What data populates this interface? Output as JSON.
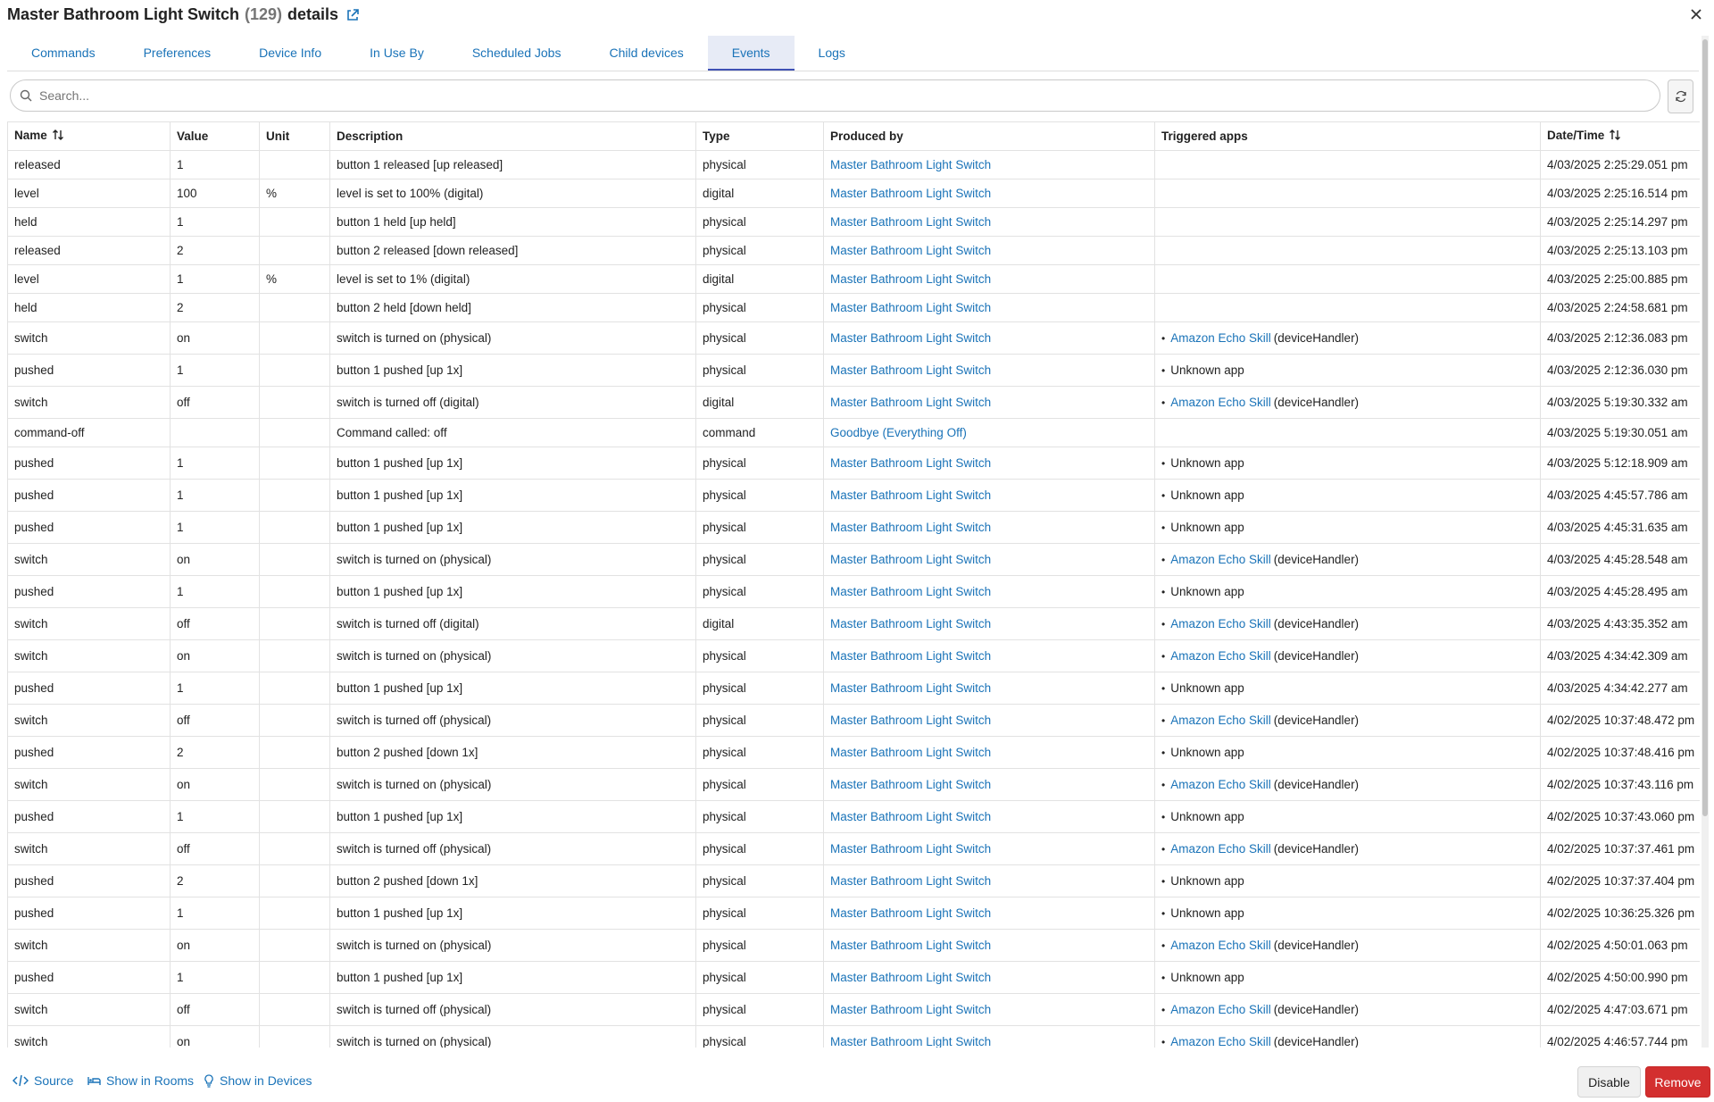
{
  "header": {
    "title": "Master Bathroom Light Switch",
    "count": "(129)",
    "suffix": "details"
  },
  "tabs": [
    {
      "label": "Commands",
      "active": false
    },
    {
      "label": "Preferences",
      "active": false
    },
    {
      "label": "Device Info",
      "active": false
    },
    {
      "label": "In Use By",
      "active": false
    },
    {
      "label": "Scheduled Jobs",
      "active": false
    },
    {
      "label": "Child devices",
      "active": false
    },
    {
      "label": "Events",
      "active": true
    },
    {
      "label": "Logs",
      "active": false
    }
  ],
  "search": {
    "placeholder": "Search...",
    "value": ""
  },
  "table": {
    "columns": [
      "Name",
      "Value",
      "Unit",
      "Description",
      "Type",
      "Produced by",
      "Triggered apps",
      "Date/Time"
    ],
    "rows": [
      {
        "name": "released",
        "value": "1",
        "unit": "",
        "description": "button 1 released [up released]",
        "type": "physical",
        "produced_by": "Master Bathroom Light Switch",
        "app": "",
        "app_suffix": "",
        "datetime": "4/03/2025 2:25:29.051 pm"
      },
      {
        "name": "level",
        "value": "100",
        "unit": "%",
        "description": "level is set to 100% (digital)",
        "type": "digital",
        "produced_by": "Master Bathroom Light Switch",
        "app": "",
        "app_suffix": "",
        "datetime": "4/03/2025 2:25:16.514 pm"
      },
      {
        "name": "held",
        "value": "1",
        "unit": "",
        "description": "button 1 held [up held]",
        "type": "physical",
        "produced_by": "Master Bathroom Light Switch",
        "app": "",
        "app_suffix": "",
        "datetime": "4/03/2025 2:25:14.297 pm"
      },
      {
        "name": "released",
        "value": "2",
        "unit": "",
        "description": "button 2 released [down released]",
        "type": "physical",
        "produced_by": "Master Bathroom Light Switch",
        "app": "",
        "app_suffix": "",
        "datetime": "4/03/2025 2:25:13.103 pm"
      },
      {
        "name": "level",
        "value": "1",
        "unit": "%",
        "description": "level is set to 1% (digital)",
        "type": "digital",
        "produced_by": "Master Bathroom Light Switch",
        "app": "",
        "app_suffix": "",
        "datetime": "4/03/2025 2:25:00.885 pm"
      },
      {
        "name": "held",
        "value": "2",
        "unit": "",
        "description": "button 2 held [down held]",
        "type": "physical",
        "produced_by": "Master Bathroom Light Switch",
        "app": "",
        "app_suffix": "",
        "datetime": "4/03/2025 2:24:58.681 pm"
      },
      {
        "name": "switch",
        "value": "on",
        "unit": "",
        "description": "switch is turned on (physical)",
        "type": "physical",
        "produced_by": "Master Bathroom Light Switch",
        "app": "Amazon Echo Skill",
        "app_link": true,
        "app_suffix": "(deviceHandler)",
        "datetime": "4/03/2025 2:12:36.083 pm"
      },
      {
        "name": "pushed",
        "value": "1",
        "unit": "",
        "description": "button 1 pushed [up 1x]",
        "type": "physical",
        "produced_by": "Master Bathroom Light Switch",
        "app": "Unknown app",
        "app_link": false,
        "app_suffix": "",
        "datetime": "4/03/2025 2:12:36.030 pm"
      },
      {
        "name": "switch",
        "value": "off",
        "unit": "",
        "description": "switch is turned off (digital)",
        "type": "digital",
        "produced_by": "Master Bathroom Light Switch",
        "app": "Amazon Echo Skill",
        "app_link": true,
        "app_suffix": "(deviceHandler)",
        "datetime": "4/03/2025 5:19:30.332 am"
      },
      {
        "name": "command-off",
        "value": "",
        "unit": "",
        "description": "Command called: off",
        "type": "command",
        "produced_by": "Goodbye (Everything Off)",
        "app": "",
        "app_suffix": "",
        "datetime": "4/03/2025 5:19:30.051 am"
      },
      {
        "name": "pushed",
        "value": "1",
        "unit": "",
        "description": "button 1 pushed [up 1x]",
        "type": "physical",
        "produced_by": "Master Bathroom Light Switch",
        "app": "Unknown app",
        "app_link": false,
        "app_suffix": "",
        "datetime": "4/03/2025 5:12:18.909 am"
      },
      {
        "name": "pushed",
        "value": "1",
        "unit": "",
        "description": "button 1 pushed [up 1x]",
        "type": "physical",
        "produced_by": "Master Bathroom Light Switch",
        "app": "Unknown app",
        "app_link": false,
        "app_suffix": "",
        "datetime": "4/03/2025 4:45:57.786 am"
      },
      {
        "name": "pushed",
        "value": "1",
        "unit": "",
        "description": "button 1 pushed [up 1x]",
        "type": "physical",
        "produced_by": "Master Bathroom Light Switch",
        "app": "Unknown app",
        "app_link": false,
        "app_suffix": "",
        "datetime": "4/03/2025 4:45:31.635 am"
      },
      {
        "name": "switch",
        "value": "on",
        "unit": "",
        "description": "switch is turned on (physical)",
        "type": "physical",
        "produced_by": "Master Bathroom Light Switch",
        "app": "Amazon Echo Skill",
        "app_link": true,
        "app_suffix": "(deviceHandler)",
        "datetime": "4/03/2025 4:45:28.548 am"
      },
      {
        "name": "pushed",
        "value": "1",
        "unit": "",
        "description": "button 1 pushed [up 1x]",
        "type": "physical",
        "produced_by": "Master Bathroom Light Switch",
        "app": "Unknown app",
        "app_link": false,
        "app_suffix": "",
        "datetime": "4/03/2025 4:45:28.495 am"
      },
      {
        "name": "switch",
        "value": "off",
        "unit": "",
        "description": "switch is turned off (digital)",
        "type": "digital",
        "produced_by": "Master Bathroom Light Switch",
        "app": "Amazon Echo Skill",
        "app_link": true,
        "app_suffix": "(deviceHandler)",
        "datetime": "4/03/2025 4:43:35.352 am"
      },
      {
        "name": "switch",
        "value": "on",
        "unit": "",
        "description": "switch is turned on (physical)",
        "type": "physical",
        "produced_by": "Master Bathroom Light Switch",
        "app": "Amazon Echo Skill",
        "app_link": true,
        "app_suffix": "(deviceHandler)",
        "datetime": "4/03/2025 4:34:42.309 am"
      },
      {
        "name": "pushed",
        "value": "1",
        "unit": "",
        "description": "button 1 pushed [up 1x]",
        "type": "physical",
        "produced_by": "Master Bathroom Light Switch",
        "app": "Unknown app",
        "app_link": false,
        "app_suffix": "",
        "datetime": "4/03/2025 4:34:42.277 am"
      },
      {
        "name": "switch",
        "value": "off",
        "unit": "",
        "description": "switch is turned off (physical)",
        "type": "physical",
        "produced_by": "Master Bathroom Light Switch",
        "app": "Amazon Echo Skill",
        "app_link": true,
        "app_suffix": "(deviceHandler)",
        "datetime": "4/02/2025 10:37:48.472 pm"
      },
      {
        "name": "pushed",
        "value": "2",
        "unit": "",
        "description": "button 2 pushed [down 1x]",
        "type": "physical",
        "produced_by": "Master Bathroom Light Switch",
        "app": "Unknown app",
        "app_link": false,
        "app_suffix": "",
        "datetime": "4/02/2025 10:37:48.416 pm"
      },
      {
        "name": "switch",
        "value": "on",
        "unit": "",
        "description": "switch is turned on (physical)",
        "type": "physical",
        "produced_by": "Master Bathroom Light Switch",
        "app": "Amazon Echo Skill",
        "app_link": true,
        "app_suffix": "(deviceHandler)",
        "datetime": "4/02/2025 10:37:43.116 pm"
      },
      {
        "name": "pushed",
        "value": "1",
        "unit": "",
        "description": "button 1 pushed [up 1x]",
        "type": "physical",
        "produced_by": "Master Bathroom Light Switch",
        "app": "Unknown app",
        "app_link": false,
        "app_suffix": "",
        "datetime": "4/02/2025 10:37:43.060 pm"
      },
      {
        "name": "switch",
        "value": "off",
        "unit": "",
        "description": "switch is turned off (physical)",
        "type": "physical",
        "produced_by": "Master Bathroom Light Switch",
        "app": "Amazon Echo Skill",
        "app_link": true,
        "app_suffix": "(deviceHandler)",
        "datetime": "4/02/2025 10:37:37.461 pm"
      },
      {
        "name": "pushed",
        "value": "2",
        "unit": "",
        "description": "button 2 pushed [down 1x]",
        "type": "physical",
        "produced_by": "Master Bathroom Light Switch",
        "app": "Unknown app",
        "app_link": false,
        "app_suffix": "",
        "datetime": "4/02/2025 10:37:37.404 pm"
      },
      {
        "name": "pushed",
        "value": "1",
        "unit": "",
        "description": "button 1 pushed [up 1x]",
        "type": "physical",
        "produced_by": "Master Bathroom Light Switch",
        "app": "Unknown app",
        "app_link": false,
        "app_suffix": "",
        "datetime": "4/02/2025 10:36:25.326 pm"
      },
      {
        "name": "switch",
        "value": "on",
        "unit": "",
        "description": "switch is turned on (physical)",
        "type": "physical",
        "produced_by": "Master Bathroom Light Switch",
        "app": "Amazon Echo Skill",
        "app_link": true,
        "app_suffix": "(deviceHandler)",
        "datetime": "4/02/2025 4:50:01.063 pm"
      },
      {
        "name": "pushed",
        "value": "1",
        "unit": "",
        "description": "button 1 pushed [up 1x]",
        "type": "physical",
        "produced_by": "Master Bathroom Light Switch",
        "app": "Unknown app",
        "app_link": false,
        "app_suffix": "",
        "datetime": "4/02/2025 4:50:00.990 pm"
      },
      {
        "name": "switch",
        "value": "off",
        "unit": "",
        "description": "switch is turned off (physical)",
        "type": "physical",
        "produced_by": "Master Bathroom Light Switch",
        "app": "Amazon Echo Skill",
        "app_link": true,
        "app_suffix": "(deviceHandler)",
        "datetime": "4/02/2025 4:47:03.671 pm"
      },
      {
        "name": "switch",
        "value": "on",
        "unit": "",
        "description": "switch is turned on (physical)",
        "type": "physical",
        "produced_by": "Master Bathroom Light Switch",
        "app": "Amazon Echo Skill",
        "app_link": true,
        "app_suffix": "(deviceHandler)",
        "datetime": "4/02/2025 4:46:57.744 pm"
      }
    ]
  },
  "footer": {
    "source_label": "Source",
    "rooms_label": "Show in Rooms",
    "devices_label": "Show in Devices",
    "disable_label": "Disable",
    "remove_label": "Remove"
  },
  "colors": {
    "link": "#1a73b8",
    "active_tab_bg": "#e7ebf6",
    "active_tab_indicator": "#3f51b5",
    "remove_button": "#d32f2f"
  }
}
